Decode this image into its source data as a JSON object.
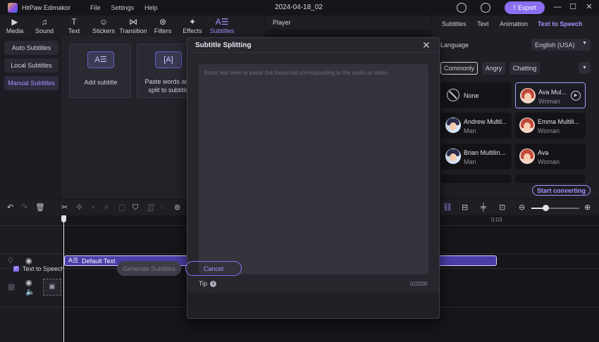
{
  "titlebar": {
    "app_name": "HitPaw Edimakor",
    "menu": [
      "File",
      "Settings",
      "Help"
    ],
    "project_title": "2024-04-18_02",
    "export_label": "Export"
  },
  "toolbar": {
    "tools": [
      {
        "label": "Media",
        "icon": "media-icon"
      },
      {
        "label": "Sound",
        "icon": "music-note-icon"
      },
      {
        "label": "Text",
        "icon": "text-t-icon"
      },
      {
        "label": "Stickers",
        "icon": "smiley-icon"
      },
      {
        "label": "Transition",
        "icon": "bowtie-icon"
      },
      {
        "label": "Filters",
        "icon": "filter-circles-icon"
      },
      {
        "label": "Effects",
        "icon": "sparkle-icon"
      },
      {
        "label": "Subtitles",
        "icon": "subtitle-icon"
      }
    ],
    "active": "Subtitles"
  },
  "sidebar": {
    "items": [
      "Auto Subtitles",
      "Local Subtitles",
      "Manual Subtitles"
    ],
    "active": "Manual Subtitles"
  },
  "media_cards": [
    {
      "label": "Add subtitle"
    },
    {
      "label_line1": "Paste words and",
      "label_line2": "split to subtitle"
    }
  ],
  "player": {
    "label": "Player"
  },
  "right_panel": {
    "tabs": [
      "Subtitles",
      "Text",
      "Animation",
      "Text to Speech"
    ],
    "active_tab": "Text to Speech",
    "language_label": "Language",
    "language_value": "English (USA)",
    "emotions": [
      "Commonly",
      "Angry",
      "Chatting"
    ],
    "active_emotion": "Commonly",
    "voices": [
      {
        "name": "None",
        "gender": ""
      },
      {
        "name": "Ava Mul...",
        "gender": "Woman"
      },
      {
        "name": "Andrew Multil...",
        "gender": "Man"
      },
      {
        "name": "Emma Multili...",
        "gender": "Woman"
      },
      {
        "name": "Brian Multilin...",
        "gender": "Man"
      },
      {
        "name": "Ava",
        "gender": "Woman"
      }
    ],
    "start_label": "Start converting"
  },
  "timeline": {
    "ruler_label": "0:03",
    "clip_label": "Default Text"
  },
  "modal": {
    "title": "Subtitle Splitting",
    "placeholder": "Enter text here or paste the transcript corresponding to the audio or video .",
    "tip_label": "Tip",
    "char_count": "0/2000",
    "checkbox_label": "Text to Speech",
    "generate_label": "Generate Subtitles",
    "cancel_label": "Cancel"
  },
  "colors": {
    "accent": "#8c6ef0",
    "accent_text": "#a990ff",
    "background": "#1a1a1f",
    "clip": "#4a3fa8"
  }
}
